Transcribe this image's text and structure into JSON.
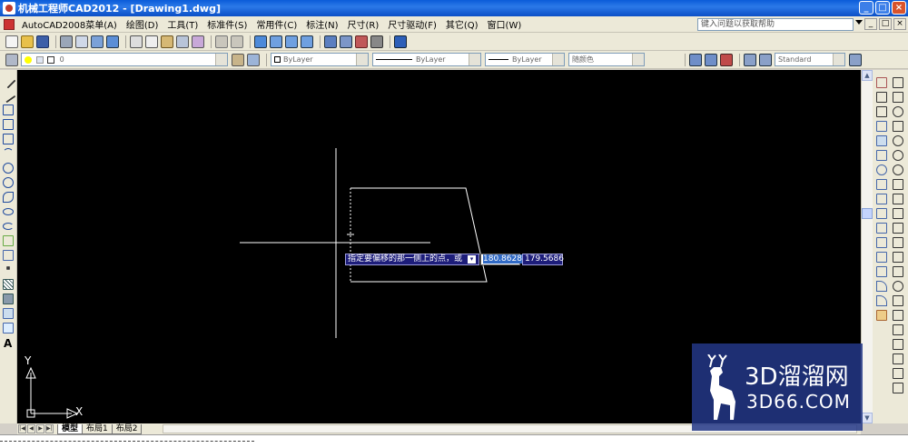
{
  "window": {
    "title": "机械工程师CAD2012 - [Drawing1.dwg]",
    "controls": [
      "_",
      "□",
      "×"
    ]
  },
  "menubar": {
    "items": [
      "AutoCAD2008菜单(A)",
      "绘图(D)",
      "工具(T)",
      "标准件(S)",
      "常用件(C)",
      "标注(N)",
      "尺寸(R)",
      "尺寸驱动(F)",
      "其它(Q)",
      "窗口(W)"
    ],
    "help_placeholder": "键入问题以获取帮助",
    "doc_controls": [
      "_",
      "□",
      "×"
    ]
  },
  "toolbar2": {
    "layer_value": "0",
    "color_value": "ByLayer",
    "linetype_value": "ByLayer",
    "lineweight_value": "ByLayer",
    "plotstyle_value": "随颜色",
    "dimstyle_value": "Standard"
  },
  "dynamic_input": {
    "prompt": "指定要偏移的那一侧上的点，或",
    "x_value": "180.8628",
    "y_value": "179.5686"
  },
  "layout_tabs": [
    "模型",
    "布局1",
    "布局2"
  ],
  "ucs": {
    "x_label": "X",
    "y_label": "Y"
  },
  "watermark": {
    "line1": "3D溜溜网",
    "line2": "3D66.COM"
  },
  "colors": {
    "canvas": "#000000",
    "titlebar": "#0a5bd9",
    "chrome": "#ece9d8",
    "dynamic_bg": "#1d1d7a"
  }
}
